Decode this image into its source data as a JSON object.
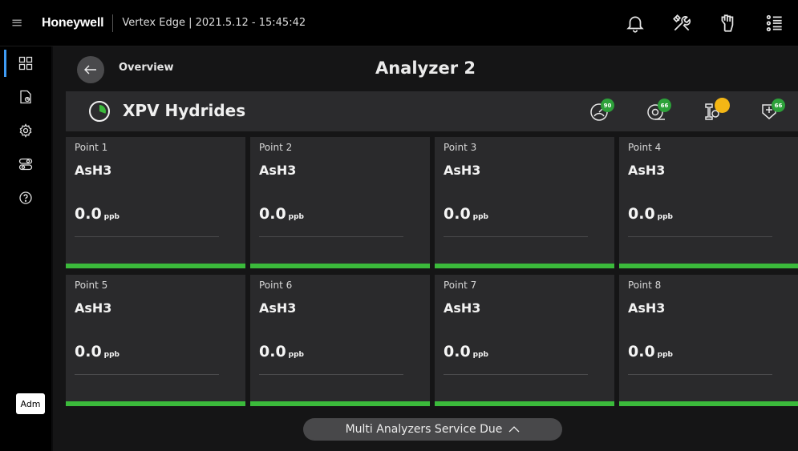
{
  "topbar": {
    "menu_glyph": "≡",
    "brand": "Honeywell",
    "device_info": "Vertex Edge | 2021.5.12 - 15:45:42",
    "icons": [
      "bell-icon",
      "tools-icon",
      "glove-icon",
      "list-icon"
    ]
  },
  "sidenav": {
    "items": [
      "dashboard-icon",
      "report-icon",
      "settings-icon",
      "toggle-icon",
      "help-icon"
    ],
    "active": "dashboard-icon",
    "user_label": "Adm"
  },
  "header": {
    "back_label": "Overview",
    "title": "Analyzer 2"
  },
  "analyzer": {
    "name": "XPV Hydrides",
    "status": [
      {
        "icon": "gauge-icon",
        "badge": "90",
        "color": "#2da13a"
      },
      {
        "icon": "tape-icon",
        "badge": "66",
        "color": "#2da13a"
      },
      {
        "icon": "pump-icon",
        "badge": "",
        "color": "#f3b615"
      },
      {
        "icon": "filter-icon",
        "badge": "66",
        "color": "#2da13a"
      }
    ]
  },
  "points": [
    {
      "label": "Point 1",
      "gas": "AsH3",
      "value": "0.0",
      "unit": "ppb"
    },
    {
      "label": "Point 2",
      "gas": "AsH3",
      "value": "0.0",
      "unit": "ppb"
    },
    {
      "label": "Point 3",
      "gas": "AsH3",
      "value": "0.0",
      "unit": "ppb"
    },
    {
      "label": "Point 4",
      "gas": "AsH3",
      "value": "0.0",
      "unit": "ppb"
    },
    {
      "label": "Point 5",
      "gas": "AsH3",
      "value": "0.0",
      "unit": "ppb"
    },
    {
      "label": "Point 6",
      "gas": "AsH3",
      "value": "0.0",
      "unit": "ppb"
    },
    {
      "label": "Point 7",
      "gas": "AsH3",
      "value": "0.0",
      "unit": "ppb"
    },
    {
      "label": "Point 8",
      "gas": "AsH3",
      "value": "0.0",
      "unit": "ppb"
    }
  ],
  "footer": {
    "service_label": "Multi Analyzers Service Due"
  },
  "colors": {
    "accent_blue": "#3f9cf5",
    "status_green": "#3bba3b",
    "warning_yellow": "#f3b615"
  }
}
